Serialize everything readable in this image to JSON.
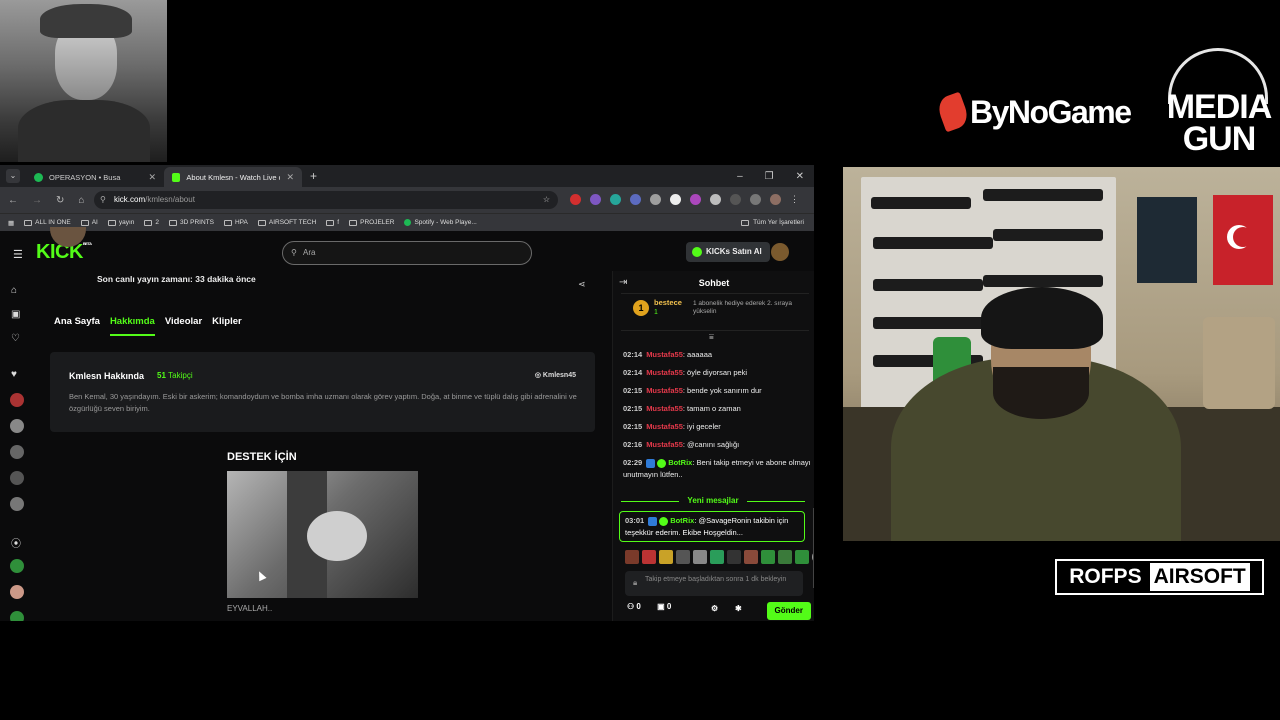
{
  "overlay": {
    "bynogame_logo": "ByNoGame",
    "mediagun_logo_line1": "MEDIA",
    "mediagun_logo_line2": "GUN",
    "rofps_logo_left": "ROFPS",
    "rofps_logo_right": "AIRSOFT"
  },
  "browser": {
    "tabs": [
      {
        "label": "OPERASYON • Busa",
        "active": false
      },
      {
        "label": "About Kmlesn - Watch Live on",
        "active": true
      }
    ],
    "url_domain": "kick.com",
    "url_path": "/kmlesn/about",
    "bookmarks": [
      {
        "label": "ALL IN ONE"
      },
      {
        "label": "AI"
      },
      {
        "label": "yayın"
      },
      {
        "label": "2"
      },
      {
        "label": "3D PRINTS"
      },
      {
        "label": "HPA"
      },
      {
        "label": "AIRSOFT TECH"
      },
      {
        "label": "f"
      },
      {
        "label": "PROJELER"
      },
      {
        "label": "Spotify - Web Playe..."
      }
    ],
    "all_bookmarks": "Tüm Yer İşaretleri"
  },
  "kick": {
    "logo": "KICK",
    "logo_badge": "BETA",
    "search_placeholder": "Ara",
    "kicks_button": "KICKs Satın Al",
    "last_live": "Son canlı yayın zamanı: 33 dakika önce",
    "tabs": [
      {
        "label": "Ana Sayfa",
        "active": false
      },
      {
        "label": "Hakkımda",
        "active": true
      },
      {
        "label": "Videolar",
        "active": false
      },
      {
        "label": "Klipler",
        "active": false
      }
    ],
    "about": {
      "title": "Kmlesn Hakkında",
      "followers_count": "51",
      "followers_label": "Takipçi",
      "instagram": "Kmlesn45",
      "bio": "Ben Kemal, 30 yaşındayım. Eski bir askerim; komandoydum ve bomba imha uzmanı olarak görev yaptım. Doğa, at binme ve tüplü dalış gibi adrenalini ve özgürlüğü seven biriyim."
    },
    "support_title": "DESTEK İÇİN",
    "support_caption": "EYVALLAH.."
  },
  "chat": {
    "title": "Sohbet",
    "top_gifter": {
      "rank": "1",
      "name": "bestece",
      "count": "1",
      "note": "1 abonelik hediye ederek 2. sıraya yükselin"
    },
    "messages": [
      {
        "time": "02:14",
        "user": "Mustafa55",
        "text": ": aaaaaa"
      },
      {
        "time": "02:14",
        "user": "Mustafa55",
        "text": ": öyle diyorsan peki"
      },
      {
        "time": "02:15",
        "user": "Mustafa55",
        "text": ": bende yok sanırım dur"
      },
      {
        "time": "02:15",
        "user": "Mustafa55",
        "text": ": tamam o zaman"
      },
      {
        "time": "02:15",
        "user": "Mustafa55",
        "text": ": iyi geceler"
      },
      {
        "time": "02:16",
        "user": "Mustafa55",
        "text": ": @canını sağlığı"
      },
      {
        "time": "02:29",
        "user": "BotRix",
        "text": ": Beni takip etmeyi ve abone olmayı unutmayın lütfen.."
      }
    ],
    "new_messages_label": "Yeni mesajlar",
    "highlight": {
      "time": "03:01",
      "user": "BotRix",
      "text": ": @SavageRonin takibin için teşekkür ederim. Ekibe Hoşgeldin..."
    },
    "input_placeholder": "Takip etmeye başladıktan sonra 1 dk bekleyin",
    "footer_points": "0",
    "footer_gifts": "0",
    "send_button": "Gönder"
  }
}
